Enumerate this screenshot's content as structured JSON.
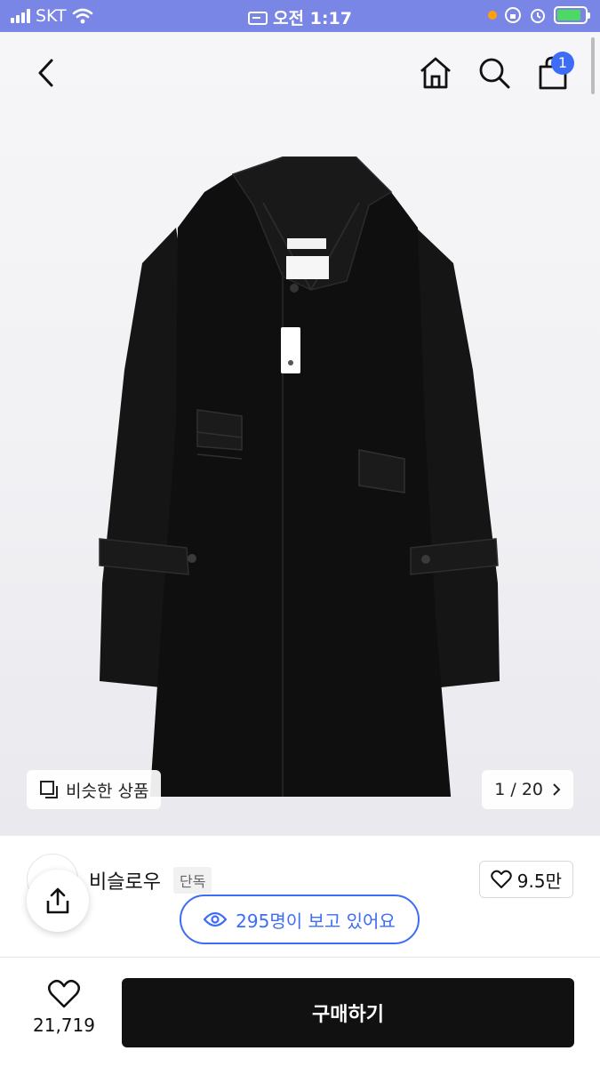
{
  "status_bar": {
    "carrier": "SKT",
    "time": "오전 1:17"
  },
  "header": {
    "cart_count": "1"
  },
  "gallery": {
    "similar_label": "비슷한 상품",
    "page_indicator": "1 / 20"
  },
  "product": {
    "brand": "비슬로우",
    "brand_badge": "단독",
    "likes": "9.5만",
    "viewers_text": "295명이 보고 있어요"
  },
  "bottom": {
    "wish_count": "21,719",
    "buy_label": "구매하기"
  },
  "colors": {
    "accent": "#3d6cf5",
    "status_bar_bg": "#7a86e6",
    "buy_bg": "#111111"
  }
}
